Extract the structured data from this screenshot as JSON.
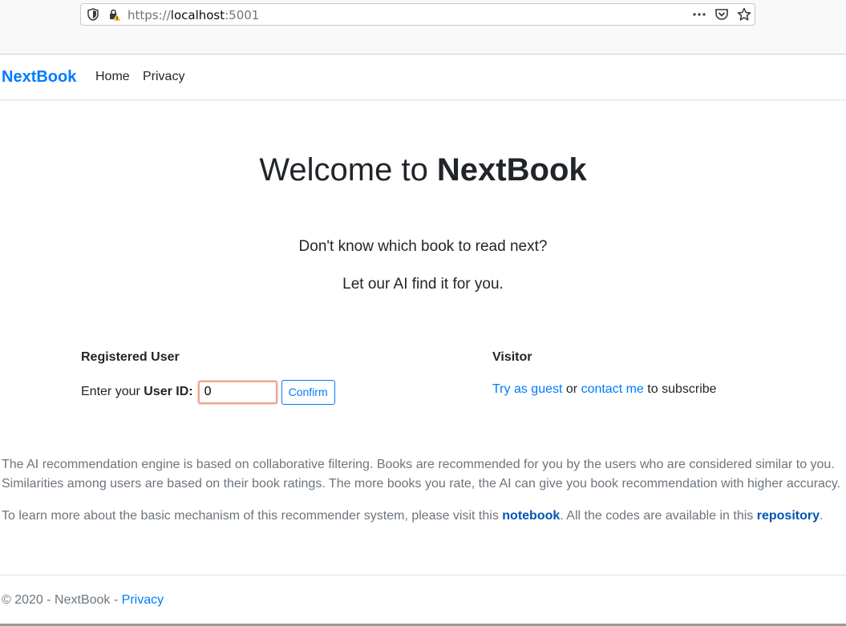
{
  "browser": {
    "url_scheme": "https://",
    "url_host": "localhost",
    "url_port": ":5001",
    "icons": [
      "shield-icon",
      "lock-warning-icon",
      "more-icon",
      "pocket-icon",
      "star-icon"
    ]
  },
  "navbar": {
    "brand": "NextBook",
    "links": [
      {
        "label": "Home"
      },
      {
        "label": "Privacy"
      }
    ]
  },
  "hero": {
    "title_prefix": "Welcome to ",
    "title_brand": "NextBook",
    "tagline_1": "Don't know which book to read next?",
    "tagline_2": "Let our AI find it for you."
  },
  "registered": {
    "heading": "Registered User",
    "label_prefix": "Enter your ",
    "label_strong": "User ID:",
    "input_value": "0",
    "confirm_label": "Confirm"
  },
  "visitor": {
    "heading": "Visitor",
    "guest_link": "Try as guest",
    "or_text": " or ",
    "contact_link": "contact me",
    "suffix": " to subscribe"
  },
  "info": {
    "para1": "The AI recommendation engine is based on collaborative filtering. Books are recommended for you by the users who are considered similar to you. Similarities among users are based on their book ratings. The more books you rate, the AI can give you book recommendation with higher accuracy.",
    "para2_prefix": "To learn more about the basic mechanism of this recommender system, please visit this ",
    "notebook_link": "notebook",
    "para2_middle": ". All the codes are available in this ",
    "repository_link": "repository",
    "para2_suffix": "."
  },
  "footer": {
    "text": "© 2020 - NextBook - ",
    "privacy_link": "Privacy"
  },
  "colors": {
    "accent": "#007bff",
    "muted": "#6c757d",
    "text": "#212529"
  }
}
